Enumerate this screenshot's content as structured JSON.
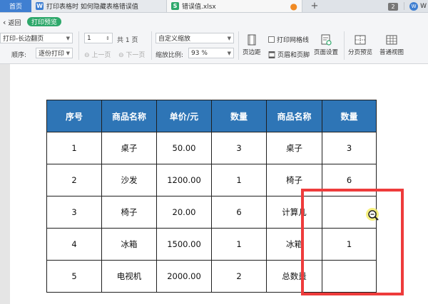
{
  "tabs": {
    "home": "首页",
    "doc_title": "打印表格时 如何隐藏表格错误值",
    "doc_badge": "W",
    "xls_title": "错误值.xlsx",
    "xls_badge": "S",
    "unsaved_dot": "●",
    "add": "+",
    "window_count": "2",
    "user_initial": "W",
    "user_label": "W"
  },
  "toolbar": {
    "back": "返回",
    "print_preview": "打印预览",
    "orientation_value": "打印-长边翻页",
    "order_label": "顺序:",
    "order_value": "逐份打印",
    "page_input": "1",
    "total_pages": "共 1 页",
    "prev_page": "上一页",
    "next_page": "下一页",
    "scale_mode": "自定义缩放",
    "zoom_label": "缩放比例:",
    "zoom_value": "93 %",
    "margins": "页边距",
    "print_gridlines": "打印网格线",
    "header_footer": "页眉和页脚",
    "page_setup": "页面设置",
    "page_break_preview": "分页预览",
    "normal_view": "普通视图"
  },
  "sheet": {
    "headers": [
      "序号",
      "商品名称",
      "单价/元",
      "数量",
      "商品名称",
      "数量"
    ],
    "rows": [
      [
        "1",
        "桌子",
        "50.00",
        "3",
        "桌子",
        "3"
      ],
      [
        "2",
        "沙发",
        "1200.00",
        "1",
        "椅子",
        "6"
      ],
      [
        "3",
        "椅子",
        "20.00",
        "6",
        "计算几",
        ""
      ],
      [
        "4",
        "冰箱",
        "1500.00",
        "1",
        "冰箱",
        "1"
      ],
      [
        "5",
        "电视机",
        "2000.00",
        "2",
        "总数量",
        ""
      ]
    ]
  },
  "colors": {
    "header_blue": "#2e75b6",
    "highlight_red": "#ee3b3b",
    "preview_green": "#2ea86b",
    "tab_blue": "#3f7fd1"
  }
}
